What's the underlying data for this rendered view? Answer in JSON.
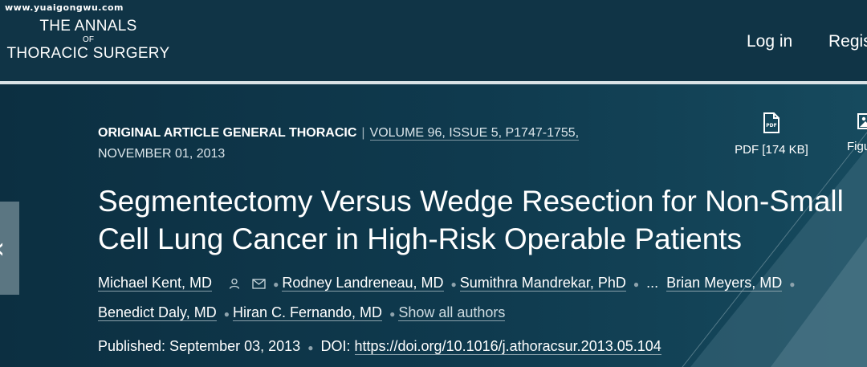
{
  "watermark": "www.yuaigongwu.com",
  "journal": {
    "line1": "THE ANNALS",
    "line2": "OF",
    "line3": "THORACIC SURGERY"
  },
  "nav": {
    "login": "Log in",
    "register": "Register"
  },
  "article": {
    "category": "ORIGINAL ARTICLE GENERAL THORACIC",
    "separator": "|",
    "volume": "VOLUME 96, ISSUE 5, P1747-1755,",
    "date": "NOVEMBER 01, 2013",
    "title": "Segmentectomy Versus Wedge Resection for Non-Small Cell Lung Cancer in High-Risk Operable Patients",
    "authors_row1": [
      "Michael Kent, MD",
      "Rodney Landreneau, MD",
      "Sumithra Mandrekar, PhD",
      "...",
      "Brian Meyers, MD"
    ],
    "authors_row2": [
      "Benedict Daly, MD",
      "Hiran C. Fernando, MD"
    ],
    "show_all": "Show all authors",
    "published_label": "Published: September 03, 2013",
    "doi_label": "DOI:",
    "doi": "https://doi.org/10.1016/j.athoracsur.2013.05.104"
  },
  "tools": {
    "pdf": "PDF [174 KB]",
    "figures": "Figures"
  },
  "icons": {
    "pdf": "pdf-icon",
    "figures": "image-icon",
    "person": "person-icon",
    "email": "envelope-icon",
    "back": "chevron-left-icon"
  },
  "colors": {
    "header_bg": "#103446",
    "content_bg": "#0d3548",
    "divider": "#d9e2e6",
    "side_tab": "#5b7682"
  }
}
